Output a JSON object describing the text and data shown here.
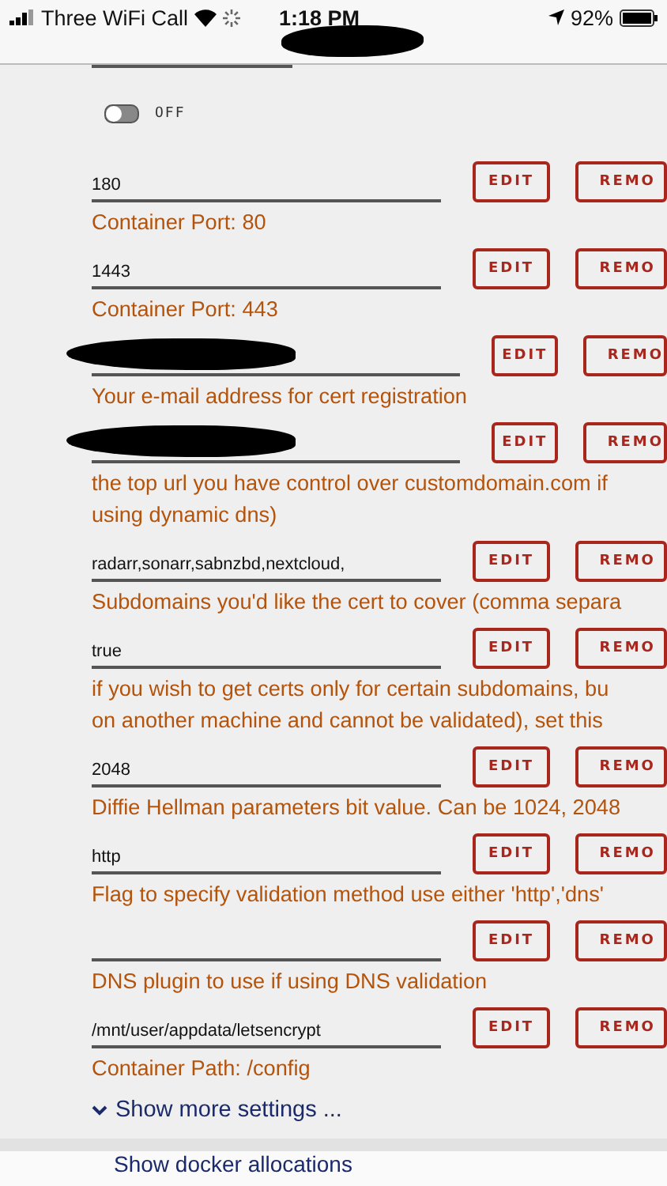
{
  "status_bar": {
    "carrier": "Three WiFi Call",
    "time": "1:18 PM",
    "battery": "92%"
  },
  "toggle": {
    "on": false,
    "label": "OFF"
  },
  "rows": [
    {
      "value": "180",
      "redacted": false,
      "description": "Container Port: 80",
      "buttons": [
        "EDIT",
        "REMO"
      ]
    },
    {
      "value": "1443",
      "redacted": false,
      "description": "Container Port: 443",
      "buttons": [
        "EDIT",
        "REMO"
      ]
    },
    {
      "redacted": true,
      "description": "Your e-mail address for cert registration",
      "buttons": [
        "EDIT",
        "REMO"
      ]
    },
    {
      "redacted": true,
      "description": "the top url you have control over customdomain.com if\nusing dynamic dns)",
      "buttons": [
        "EDIT",
        "REMO"
      ]
    },
    {
      "value": "radarr,sonarr,sabnzbd,nextcloud,",
      "redacted": false,
      "description": "Subdomains you'd like the cert to cover (comma separa",
      "buttons": [
        "EDIT",
        "REMO"
      ]
    },
    {
      "value": "true",
      "redacted": false,
      "description": "if you wish to get certs only for certain subdomains, bu\non another machine and cannot be validated), set this",
      "buttons": [
        "EDIT",
        "REMO"
      ]
    },
    {
      "value": "2048",
      "redacted": false,
      "description": "Diffie Hellman parameters bit value. Can be 1024, 2048",
      "buttons": [
        "EDIT",
        "REMO"
      ]
    },
    {
      "value": "http",
      "redacted": false,
      "description": "Flag to specify validation method use either 'http','dns'",
      "buttons": [
        "EDIT",
        "REMO"
      ]
    },
    {
      "redacted": false,
      "description": "DNS plugin to use if using DNS validation",
      "buttons": [
        "EDIT",
        "REMO"
      ]
    },
    {
      "value": "/mnt/user/appdata/letsencrypt",
      "redacted": false,
      "description": "Container Path: /config",
      "buttons": [
        "EDIT",
        "REMO"
      ]
    }
  ],
  "show_more": "Show more settings ...",
  "next_section": "Show docker allocations"
}
